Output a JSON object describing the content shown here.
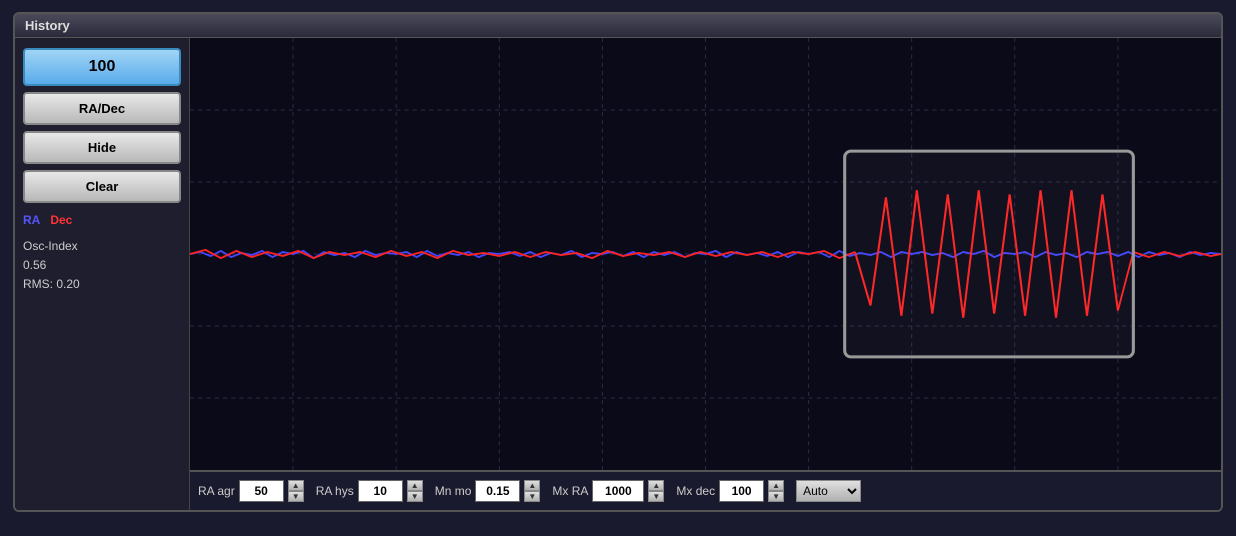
{
  "window": {
    "title": "History"
  },
  "buttons": {
    "value_100": "100",
    "ra_dec": "RA/Dec",
    "hide": "Hide",
    "clear": "Clear"
  },
  "legend": {
    "ra": "RA",
    "dec": "Dec"
  },
  "info": {
    "osc_index_label": "Osc-Index",
    "osc_index_value": "0.56",
    "rms_label": "RMS:",
    "rms_value": "0.20"
  },
  "bottom_bar": {
    "ra_agr_label": "RA agr",
    "ra_agr_value": "50",
    "ra_hys_label": "RA hys",
    "ra_hys_value": "10",
    "mn_mo_label": "Mn mo",
    "mn_mo_value": "0.15",
    "mx_ra_label": "Mx RA",
    "mx_ra_value": "1000",
    "mx_dec_label": "Mx dec",
    "mx_dec_value": "100",
    "auto_label": "Auto"
  },
  "colors": {
    "ra_line": "#4444ff",
    "dec_line": "#ff2222",
    "grid": "#2a2a4a",
    "grid_dashed": "#333355"
  }
}
